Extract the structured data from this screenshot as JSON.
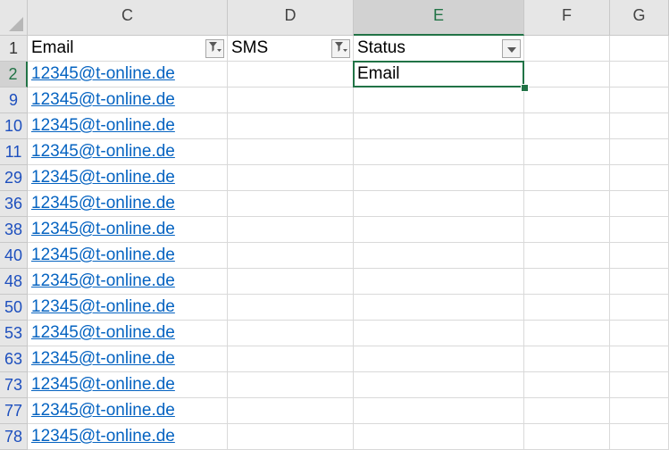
{
  "columns": [
    {
      "label": "C",
      "active": false
    },
    {
      "label": "D",
      "active": false
    },
    {
      "label": "E",
      "active": true
    },
    {
      "label": "F",
      "active": false
    },
    {
      "label": "G",
      "active": false
    }
  ],
  "header_row": {
    "number": "1",
    "cells": [
      "Email",
      "SMS",
      "Status",
      "",
      ""
    ],
    "filters": [
      "filter-applied-icon",
      "filter-applied-icon",
      "dropdown-arrow-icon"
    ]
  },
  "rows": [
    {
      "number": "2",
      "email": "12345@t-online.de",
      "sms": "",
      "status": "Email"
    },
    {
      "number": "9",
      "email": "12345@t-online.de",
      "sms": "",
      "status": ""
    },
    {
      "number": "10",
      "email": "12345@t-online.de",
      "sms": "",
      "status": ""
    },
    {
      "number": "11",
      "email": "12345@t-online.de",
      "sms": "",
      "status": ""
    },
    {
      "number": "29",
      "email": "12345@t-online.de",
      "sms": "",
      "status": ""
    },
    {
      "number": "36",
      "email": "12345@t-online.de",
      "sms": "",
      "status": ""
    },
    {
      "number": "38",
      "email": "12345@t-online.de",
      "sms": "",
      "status": ""
    },
    {
      "number": "40",
      "email": "12345@t-online.de",
      "sms": "",
      "status": ""
    },
    {
      "number": "48",
      "email": "12345@t-online.de",
      "sms": "",
      "status": ""
    },
    {
      "number": "50",
      "email": "12345@t-online.de",
      "sms": "",
      "status": ""
    },
    {
      "number": "53",
      "email": "12345@t-online.de",
      "sms": "",
      "status": ""
    },
    {
      "number": "63",
      "email": "12345@t-online.de",
      "sms": "",
      "status": ""
    },
    {
      "number": "73",
      "email": "12345@t-online.de",
      "sms": "",
      "status": ""
    },
    {
      "number": "77",
      "email": "12345@t-online.de",
      "sms": "",
      "status": ""
    },
    {
      "number": "78",
      "email": "12345@t-online.de",
      "sms": "",
      "status": ""
    }
  ],
  "selection": {
    "column": "E",
    "row": "2"
  },
  "colors": {
    "accent": "#217346",
    "link": "#0563c1",
    "row_number_filtered": "#1d4fbe"
  }
}
